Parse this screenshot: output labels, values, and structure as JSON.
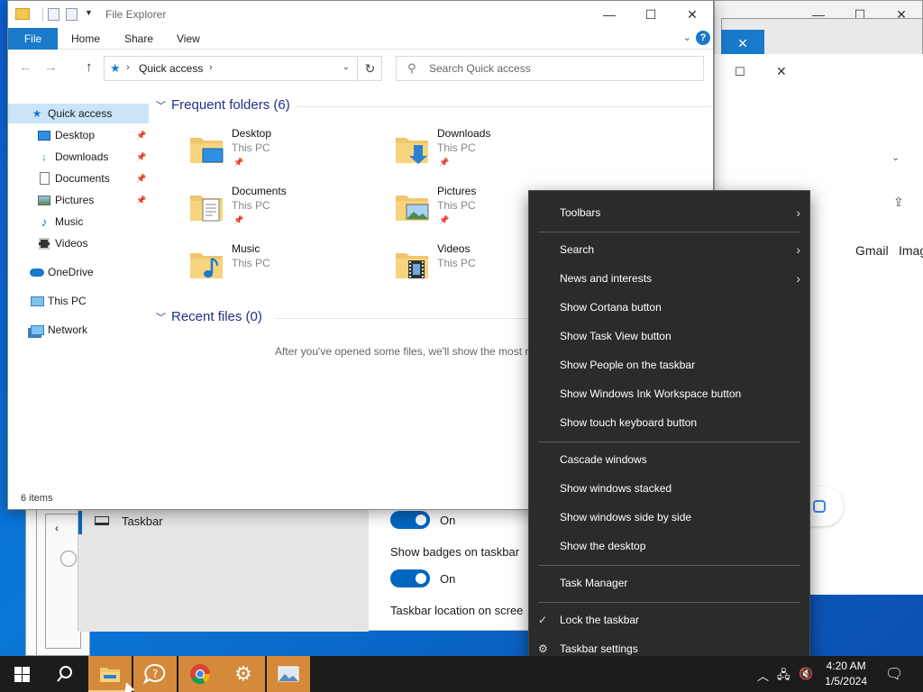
{
  "explorer": {
    "title": "File Explorer",
    "ribbon_tabs": [
      "File",
      "Home",
      "Share",
      "View"
    ],
    "help_label": "?",
    "breadcrumb": "Quick access",
    "search_placeholder": "Search Quick access",
    "status_text": "6 items",
    "nav_items": [
      {
        "label": "Quick access",
        "icon": "star-icon",
        "pinned": false
      },
      {
        "label": "Desktop",
        "icon": "desktop-icon",
        "pinned": true
      },
      {
        "label": "Downloads",
        "icon": "download-arrow-icon",
        "pinned": true
      },
      {
        "label": "Documents",
        "icon": "document-icon",
        "pinned": true
      },
      {
        "label": "Pictures",
        "icon": "pictures-icon",
        "pinned": true
      },
      {
        "label": "Music",
        "icon": "music-note-icon",
        "pinned": false
      },
      {
        "label": "Videos",
        "icon": "film-icon",
        "pinned": false
      },
      {
        "label": "OneDrive",
        "icon": "cloud-icon",
        "pinned": false
      },
      {
        "label": "This PC",
        "icon": "monitor-icon",
        "pinned": false
      },
      {
        "label": "Network",
        "icon": "network-icon",
        "pinned": false
      }
    ],
    "frequent_title": "Frequent folders (6)",
    "recent_title": "Recent files (0)",
    "recent_empty_message": "After you've opened some files, we'll show the most rec",
    "folders": [
      {
        "name": "Desktop",
        "location": "This PC",
        "pinned": true,
        "icon": "desktop-folder-icon"
      },
      {
        "name": "Downloads",
        "location": "This PC",
        "pinned": true,
        "icon": "downloads-folder-icon"
      },
      {
        "name": "Documents",
        "location": "This PC",
        "pinned": true,
        "icon": "documents-folder-icon"
      },
      {
        "name": "Pictures",
        "location": "This PC",
        "pinned": true,
        "icon": "pictures-folder-icon"
      },
      {
        "name": "Music",
        "location": "This PC",
        "pinned": false,
        "icon": "music-folder-icon"
      },
      {
        "name": "Videos",
        "location": "This PC",
        "pinned": false,
        "icon": "videos-folder-icon"
      }
    ]
  },
  "settings_window": {
    "sidebar_item": "Taskbar",
    "toggle1_state": "On",
    "badges_label": "Show badges on taskbar",
    "toggle2_state": "On",
    "location_label": "Taskbar location on scree"
  },
  "browser": {
    "gmail_link": "Gmail",
    "images_link": "Imag"
  },
  "context_menu": {
    "items": [
      {
        "label": "Toolbars",
        "submenu": true
      },
      {
        "label": "Search",
        "submenu": true
      },
      {
        "label": "News and interests",
        "submenu": true
      },
      {
        "label": "Show Cortana button"
      },
      {
        "label": "Show Task View button"
      },
      {
        "label": "Show People on the taskbar"
      },
      {
        "label": "Show Windows Ink Workspace button"
      },
      {
        "label": "Show touch keyboard button"
      },
      {
        "label": "Cascade windows"
      },
      {
        "label": "Show windows stacked"
      },
      {
        "label": "Show windows side by side"
      },
      {
        "label": "Show the desktop"
      },
      {
        "label": "Task Manager"
      },
      {
        "label": "Lock the taskbar",
        "checked": true
      },
      {
        "label": "Taskbar settings",
        "gear": true
      }
    ]
  },
  "taskbar": {
    "time": "4:20 AM",
    "date": "1/5/2024",
    "apps": [
      "file-explorer-icon",
      "help-icon",
      "chrome-icon",
      "settings-gear-icon",
      "photos-icon"
    ]
  },
  "colors": {
    "accent": "#1979ca",
    "menu_bg": "#2b2b2b",
    "taskbar_bg": "#1c1c1c",
    "taskbar_app_bg": "#d48a3a",
    "toggle_on": "#0067c0"
  }
}
